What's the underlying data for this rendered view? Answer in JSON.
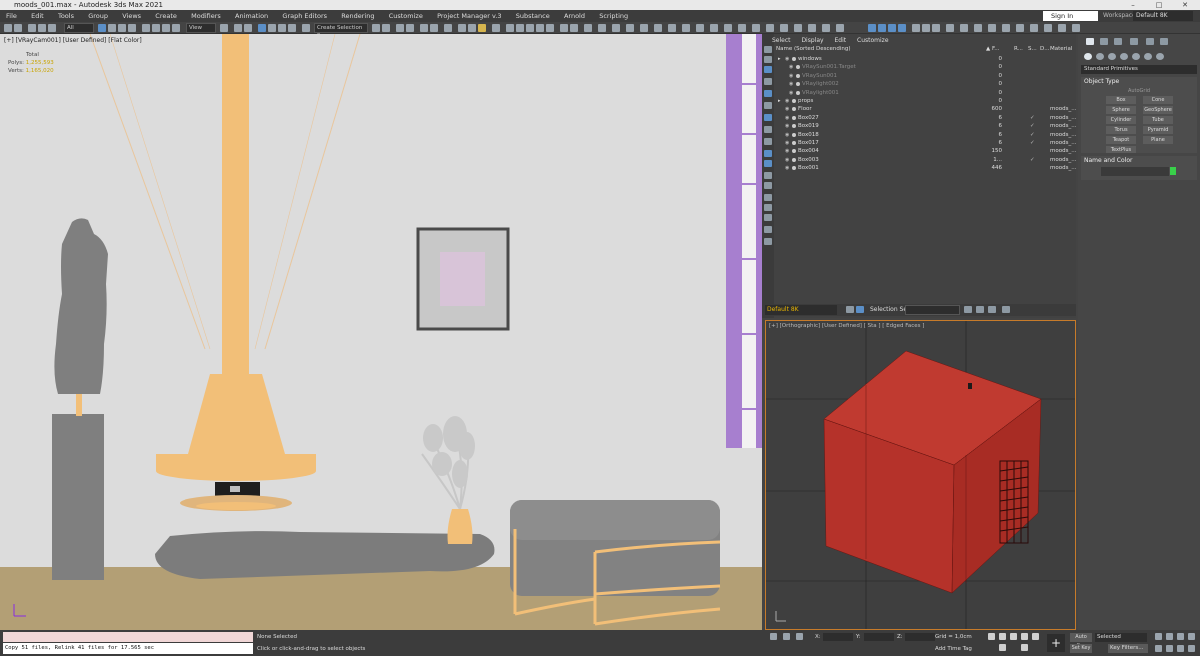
{
  "window": {
    "title": "moods_001.max - Autodesk 3ds Max 2021",
    "controls": [
      "–",
      "□",
      "✕"
    ]
  },
  "menu": [
    "File",
    "Edit",
    "Tools",
    "Group",
    "Views",
    "Create",
    "Modifiers",
    "Animation",
    "Graph Editors",
    "Rendering",
    "Customize",
    "Project Manager v.3",
    "Substance",
    "Arnold",
    "Scripting"
  ],
  "account": {
    "sign_in": "Sign In",
    "workspaces_label": "Workspaces:",
    "workspace_value": "Default 8K"
  },
  "toolbar": {
    "filter_value": "All",
    "view_value": "View",
    "selection_set_placeholder": "Create Selection Se"
  },
  "viewport_left": {
    "label": "[+] [VRayCam001] [User Defined] [Flat Color]",
    "stats": {
      "total": "Total",
      "polys_label": "Polys:",
      "polys_value": "1,255,593",
      "verts_label": "Verts:",
      "verts_value": "1,165,020"
    }
  },
  "scene_explorer": {
    "menu": [
      "Select",
      "Display",
      "Edit",
      "Customize"
    ],
    "columns": {
      "name": "Name (Sorted Descending)",
      "faces": "▲ F...",
      "r": "R...",
      "s": "S...",
      "d": "D...",
      "material": "Material"
    },
    "rows": [
      {
        "name": "windows",
        "count": "0",
        "material": "",
        "type": "group",
        "dim": false
      },
      {
        "name": "VRaySun001.Target",
        "count": "0",
        "material": "",
        "type": "light",
        "dim": true
      },
      {
        "name": "VRaySun001",
        "count": "0",
        "material": "",
        "type": "light",
        "dim": true
      },
      {
        "name": "VRaylight002",
        "count": "0",
        "material": "",
        "type": "light",
        "dim": true
      },
      {
        "name": "VRaylight001",
        "count": "0",
        "material": "",
        "type": "light",
        "dim": true
      },
      {
        "name": "props",
        "count": "0",
        "material": "",
        "type": "group",
        "dim": false
      },
      {
        "name": "Floor",
        "count": "600",
        "material": "moods_...",
        "type": "mesh",
        "dim": false
      },
      {
        "name": "Box027",
        "count": "6",
        "material": "moods_...",
        "type": "mesh",
        "dim": false
      },
      {
        "name": "Box019",
        "count": "6",
        "material": "moods_...",
        "type": "mesh",
        "dim": false
      },
      {
        "name": "Box018",
        "count": "6",
        "material": "moods_...",
        "type": "mesh",
        "dim": false
      },
      {
        "name": "Box017",
        "count": "6",
        "material": "moods_...",
        "type": "mesh",
        "dim": false
      },
      {
        "name": "Box004",
        "count": "150",
        "material": "moods_...",
        "type": "mesh",
        "dim": false
      },
      {
        "name": "Box003",
        "count": "1...",
        "material": "moods_...",
        "type": "mesh",
        "dim": false
      },
      {
        "name": "Box001",
        "count": "446",
        "material": "moods_...",
        "type": "mesh",
        "dim": false
      }
    ],
    "footer": {
      "layer": "Default 8K",
      "selection_set_label": "Selection Set:"
    }
  },
  "viewport_right": {
    "label": "[+] [Orthographic] [User Defined] [ Sta ] [ Edged Faces ]"
  },
  "command_panel": {
    "category": "Standard Primitives",
    "object_type": {
      "title": "Object Type",
      "autogrid": "AutoGrid",
      "buttons": [
        "Box",
        "Cone",
        "Sphere",
        "GeoSphere",
        "Cylinder",
        "Tube",
        "Torus",
        "Pyramid",
        "Teapot",
        "Plane",
        "TextPlus"
      ]
    },
    "name_and_color": {
      "title": "Name and Color",
      "color": "#39d04a"
    }
  },
  "bottom": {
    "maxscript_output": "Copy 51 files, Relink 41 files for 17.565 sec",
    "status_selection": "None Selected",
    "status_prompt": "Click or click-and-drag to select objects",
    "x_label": "X:",
    "y_label": "Y:",
    "z_label": "Z:",
    "grid": "Grid = 1,0cm",
    "add_time_tag": "Add Time Tag",
    "auto_key": "Auto Key",
    "set_key": "Set Key",
    "selected": "Selected",
    "key_filters": "Key Filters..."
  },
  "colors": {
    "fireplace": "#f2bf78",
    "window_frame": "#a77fcf",
    "box_red": "#b8332a",
    "floor": "#b39f75",
    "statue": "#7f7f7f"
  }
}
